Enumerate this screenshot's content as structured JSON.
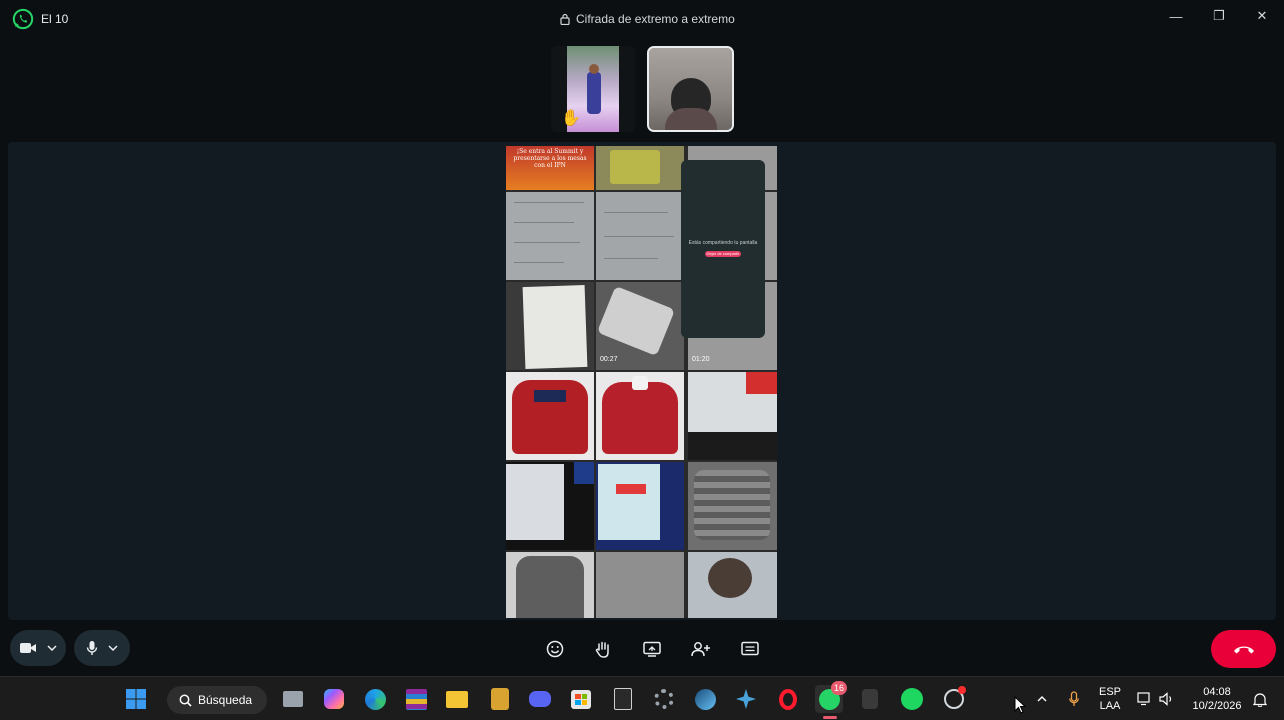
{
  "window": {
    "app_name": "El 10",
    "encryption_label": "Cifrada de extremo a extremo",
    "controls": {
      "minimize": "—",
      "restore": "❐",
      "close": "✕"
    }
  },
  "shared_screen": {
    "banner_text": "¡Se entra al Summit y presentarse a los mesas con el IPN",
    "dialog_text": "Estás compartiendo tu pantalla",
    "dialog_button": "Dejar de compartir",
    "video_durations": [
      "00:27",
      "01:20"
    ]
  },
  "call_controls": {
    "camera_icon": "video-camera-icon",
    "mic_icon": "microphone-icon",
    "center_icons": [
      "emoji-icon",
      "raise-hand-icon",
      "share-screen-icon",
      "add-participant-icon",
      "chat-icon"
    ]
  },
  "taskbar": {
    "search_label": "Búsqueda",
    "whatsapp_badge": "16",
    "language_top": "ESP",
    "language_bottom": "LAA",
    "time": "04:08",
    "date": "10/2/2026"
  },
  "colors": {
    "end_call": "#ea0038",
    "whatsapp_green": "#25d366",
    "stage_bg": "#111b21"
  }
}
